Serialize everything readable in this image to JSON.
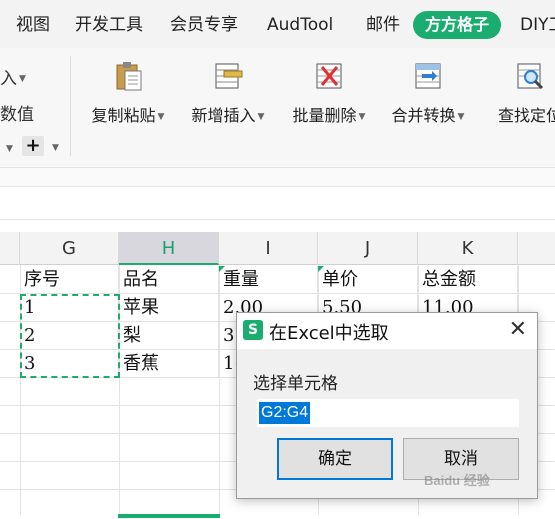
{
  "menu": {
    "tabs": [
      "视图",
      "开发工具",
      "会员专享",
      "AudTool",
      "邮件",
      "方方格子",
      "DIY工"
    ],
    "active_tab": "方方格子",
    "accent_color": "#1bad6f"
  },
  "ribbon": {
    "left_fragments": [
      "入",
      "数值"
    ],
    "buttons": [
      {
        "label": "复制粘贴",
        "icon": "clipboard-icon"
      },
      {
        "label": "新增插入",
        "icon": "insert-icon"
      },
      {
        "label": "批量删除",
        "icon": "delete-icon"
      },
      {
        "label": "合并转换",
        "icon": "merge-convert-icon"
      },
      {
        "label": "查找定位",
        "icon": "find-locate-icon"
      }
    ],
    "plus_symbol": "+"
  },
  "sheet": {
    "columns": [
      "G",
      "H",
      "I",
      "J",
      "K"
    ],
    "selected_column": "H",
    "header_row": [
      "序号",
      "品名",
      "重量",
      "单价",
      "总金额"
    ],
    "rows": [
      [
        "1",
        "苹果",
        "2.00",
        "5.50",
        "11.00"
      ],
      [
        "2",
        "梨",
        "3.",
        "",
        ""
      ],
      [
        "3",
        "香蕉",
        "1(",
        "",
        ""
      ]
    ]
  },
  "dialog": {
    "icon_letter": "S",
    "title": "在Excel中选取",
    "close_symbol": "✕",
    "label": "选择单元格",
    "value": "G2:G4",
    "ok_label": "确定",
    "cancel_label": "取消"
  },
  "watermark": "Baidu 经验"
}
